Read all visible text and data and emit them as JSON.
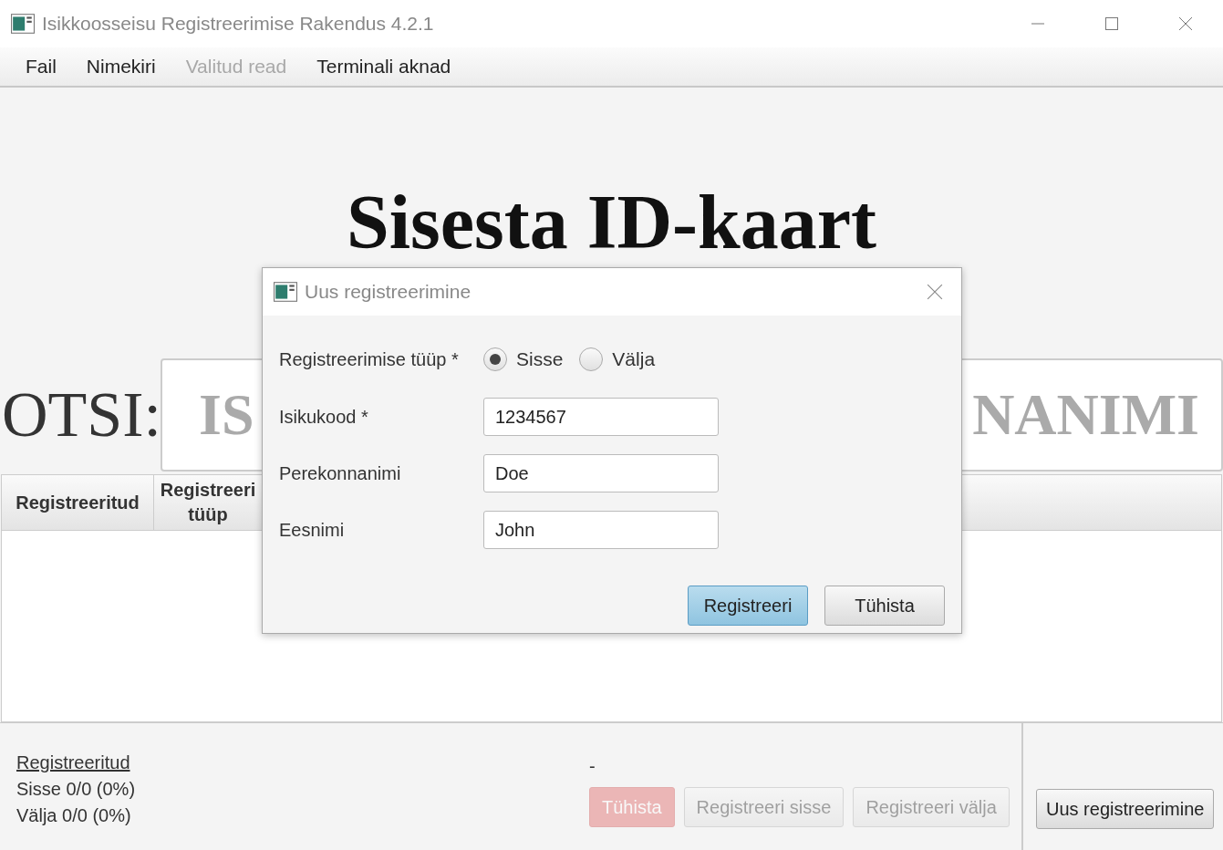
{
  "window": {
    "title": "Isikkoosseisu Registreerimise Rakendus 4.2.1"
  },
  "menu": [
    {
      "label": "Fail",
      "disabled": false
    },
    {
      "label": "Nimekiri",
      "disabled": false
    },
    {
      "label": "Valitud read",
      "disabled": true
    },
    {
      "label": "Terminali aknad",
      "disabled": false
    }
  ],
  "heading": "Sisesta ID-kaart",
  "search": {
    "label": "OTSI:",
    "placeholder_start": "IS",
    "placeholder_end": "NANIMI"
  },
  "table": {
    "columns": [
      "Registreeritud",
      "Registreeri tüüp"
    ]
  },
  "summary": {
    "title": "Registreeritud",
    "lines": [
      "Sisse 0/0 (0%)",
      "Välja 0/0 (0%)"
    ]
  },
  "status": "-",
  "actions": [
    {
      "label": "Tühista",
      "kind": "danger",
      "disabled": true
    },
    {
      "label": "Registreeri sisse",
      "kind": "normal",
      "disabled": true
    },
    {
      "label": "Registreeri välja",
      "kind": "normal",
      "disabled": true
    }
  ],
  "new_button": "Uus registreerimine",
  "dialog": {
    "title": "Uus registreerimine",
    "type_label": "Registreerimise tüüp *",
    "options": [
      {
        "label": "Sisse",
        "selected": true
      },
      {
        "label": "Välja",
        "selected": false
      }
    ],
    "fields": [
      {
        "label": "Isikukood *",
        "value": "1234567"
      },
      {
        "label": "Perekonnanimi",
        "value": "Doe"
      },
      {
        "label": "Eesnimi",
        "value": "John"
      }
    ],
    "buttons": [
      {
        "label": "Registreeri",
        "default": true
      },
      {
        "label": "Tühista",
        "default": false
      }
    ]
  }
}
